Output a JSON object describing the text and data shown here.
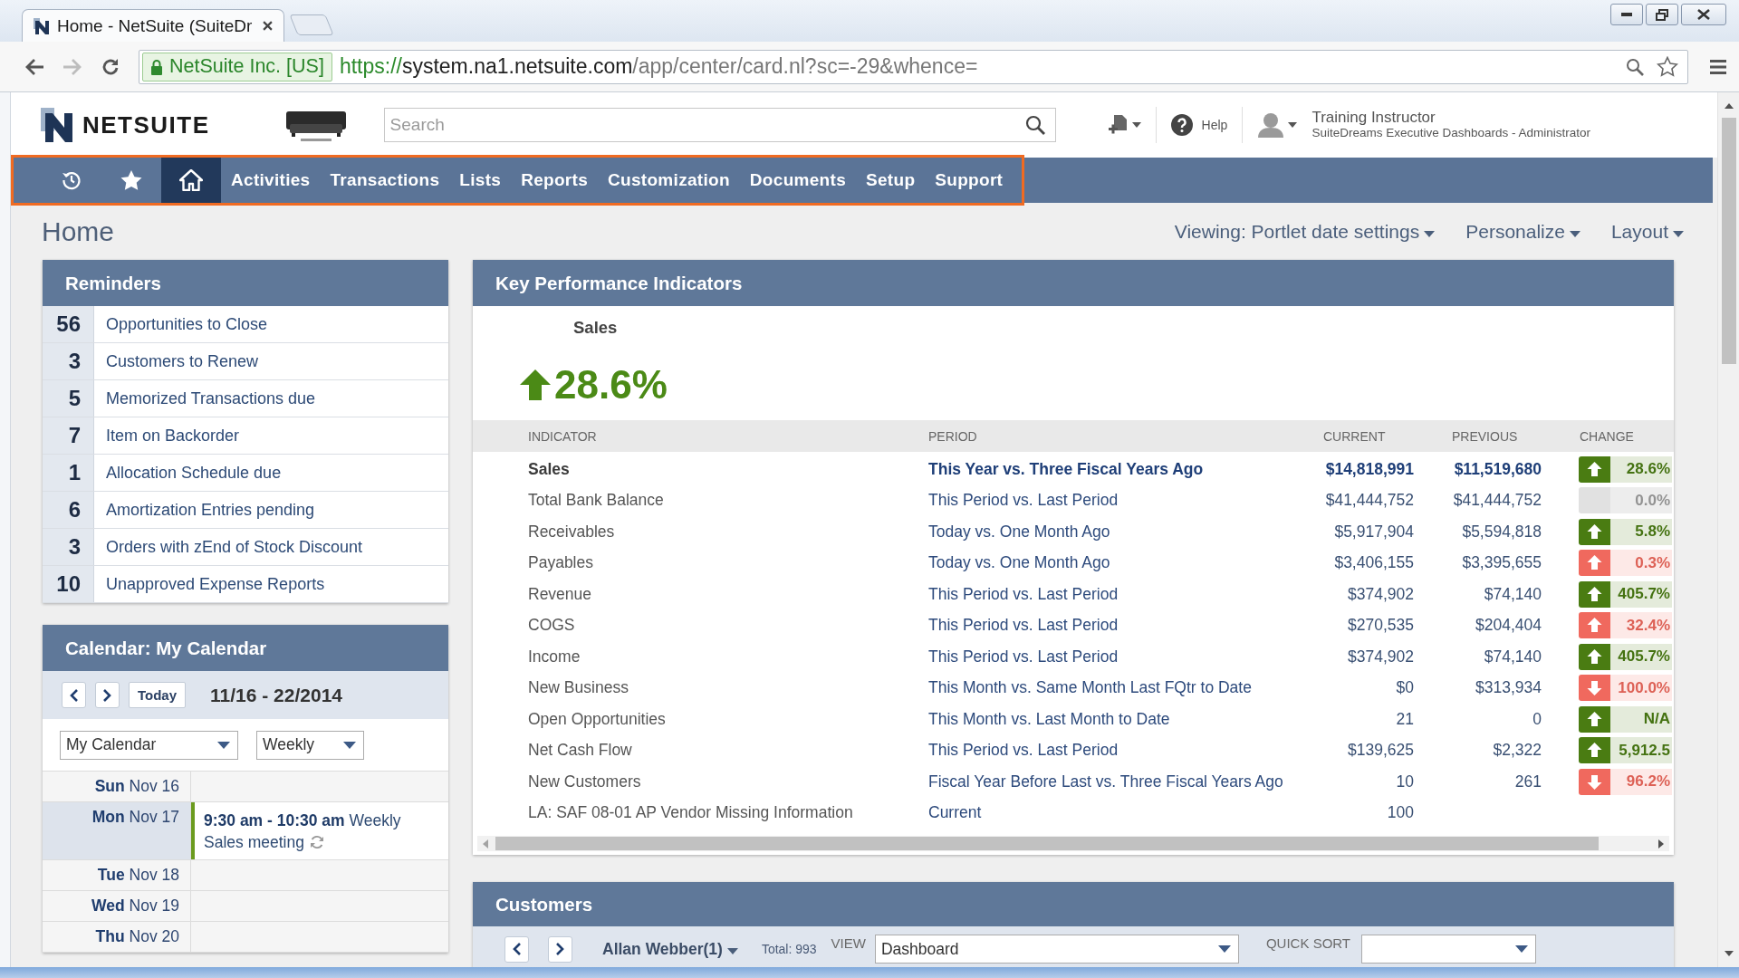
{
  "browser": {
    "tabs": [
      {
        "title": "Home - NetSuite (SuiteDr",
        "selected": true
      }
    ],
    "nav_buttons": [
      {
        "kind": "back",
        "disabled": false
      },
      {
        "kind": "forward",
        "disabled": true
      },
      {
        "kind": "reload",
        "disabled": false
      }
    ],
    "address": {
      "secure_label": "NetSuite Inc. [US]",
      "scheme": "https://",
      "host": "system.na1.netsuite.com",
      "path": "/app/center/card.nl?sc=-29&whence="
    }
  },
  "header": {
    "logo_text": "NETSUITE",
    "search": {
      "placeholder": "Search"
    },
    "help": "Help",
    "user": {
      "name": "Training Instructor",
      "role": "SuiteDreams Executive Dashboards - Administrator"
    }
  },
  "nav": {
    "highlighted": true,
    "items": [
      {
        "kind": "recent",
        "selected": false
      },
      {
        "kind": "favorites",
        "selected": false
      },
      {
        "kind": "home",
        "selected": true
      },
      {
        "kind": "menu",
        "label": "Activities",
        "selected": false
      },
      {
        "kind": "menu",
        "label": "Transactions",
        "selected": false
      },
      {
        "kind": "menu",
        "label": "Lists",
        "selected": false
      },
      {
        "kind": "menu",
        "label": "Reports",
        "selected": false
      },
      {
        "kind": "menu",
        "label": "Customization",
        "selected": false
      },
      {
        "kind": "menu",
        "label": "Documents",
        "selected": false
      },
      {
        "kind": "menu",
        "label": "Setup",
        "selected": false
      },
      {
        "kind": "menu",
        "label": "Support",
        "selected": false
      }
    ]
  },
  "page": {
    "title": "Home",
    "menus": [
      "Viewing: Portlet date settings",
      "Personalize",
      "Layout"
    ]
  },
  "reminders": {
    "title": "Reminders",
    "items": [
      {
        "count": "56",
        "label": "Opportunities to Close"
      },
      {
        "count": "3",
        "label": "Customers to Renew"
      },
      {
        "count": "5",
        "label": "Memorized Transactions due"
      },
      {
        "count": "7",
        "label": "Item on Backorder"
      },
      {
        "count": "1",
        "label": "Allocation Schedule due"
      },
      {
        "count": "6",
        "label": "Amortization Entries pending"
      },
      {
        "count": "3",
        "label": "Orders with zEnd of Stock Discount"
      },
      {
        "count": "10",
        "label": "Unapproved Expense Reports"
      }
    ]
  },
  "calendar": {
    "title": "Calendar: My Calendar",
    "today_button": "Today",
    "range": "11/16 - 22/2014",
    "calendar_select": "My Calendar",
    "view_select": "Weekly",
    "days": [
      {
        "weekday": "Sun",
        "date": "Nov 16",
        "today": false
      },
      {
        "weekday": "Mon",
        "date": "Nov 17",
        "today": true,
        "events": [
          {
            "text": "**9:30 am - 10:30 am** Weekly Sales meeting",
            "recurring": true
          }
        ]
      },
      {
        "weekday": "Tue",
        "date": "Nov 18",
        "today": false
      },
      {
        "weekday": "Wed",
        "date": "Nov 19",
        "today": false
      },
      {
        "weekday": "Thu",
        "date": "Nov 20",
        "today": false
      }
    ]
  },
  "kpi": {
    "title": "Key Performance Indicators",
    "headline": {
      "label": "Sales",
      "value": "28.6%",
      "kind": "increase",
      "color": "#4b8a16"
    },
    "columns": [
      "INDICATOR",
      "PERIOD",
      "CURRENT",
      "PREVIOUS",
      "CHANGE"
    ],
    "rows": [
      {
        "indicator": "Sales",
        "period": "This Year vs. Three Fiscal Years Ago",
        "current": "$14,818,991",
        "previous": "$11,519,680",
        "change": {
          "value": "28.6%",
          "kind": "increase",
          "color": "#4a7c12"
        },
        "selected": true
      },
      {
        "indicator": "Total Bank Balance",
        "period": "This Period vs. Last Period",
        "current": "$41,444,752",
        "previous": "$41,444,752",
        "change": {
          "value": "0.0%",
          "kind": "unchanged",
          "color": "#e1e1e1"
        },
        "selected": false
      },
      {
        "indicator": "Receivables",
        "period": "Today vs. One Month Ago",
        "current": "$5,917,904",
        "previous": "$5,594,818",
        "change": {
          "value": "5.8%",
          "kind": "increase",
          "color": "#4a7c12"
        },
        "selected": false
      },
      {
        "indicator": "Payables",
        "period": "Today vs. One Month Ago",
        "current": "$3,406,155",
        "previous": "$3,395,655",
        "change": {
          "value": "0.3%",
          "kind": "increase",
          "color": "#f0695e"
        },
        "selected": false
      },
      {
        "indicator": "Revenue",
        "period": "This Period vs. Last Period",
        "current": "$374,902",
        "previous": "$74,140",
        "change": {
          "value": "405.7%",
          "kind": "increase",
          "color": "#4a7c12"
        },
        "selected": false
      },
      {
        "indicator": "COGS",
        "period": "This Period vs. Last Period",
        "current": "$270,535",
        "previous": "$204,404",
        "change": {
          "value": "32.4%",
          "kind": "increase",
          "color": "#f0695e"
        },
        "selected": false
      },
      {
        "indicator": "Income",
        "period": "This Period vs. Last Period",
        "current": "$374,902",
        "previous": "$74,140",
        "change": {
          "value": "405.7%",
          "kind": "increase",
          "color": "#4a7c12"
        },
        "selected": false
      },
      {
        "indicator": "New Business",
        "period": "This Month vs. Same Month Last FQtr to Date",
        "current": "$0",
        "previous": "$313,934",
        "change": {
          "value": "100.0%",
          "kind": "decrease",
          "color": "#f0695e"
        },
        "selected": false
      },
      {
        "indicator": "Open Opportunities",
        "period": "This Month vs. Last Month to Date",
        "current": "21",
        "previous": "0",
        "change": {
          "value": "N/A",
          "kind": "increase",
          "color": "#4a7c12"
        },
        "selected": false
      },
      {
        "indicator": "Net Cash Flow",
        "period": "This Period vs. Last Period",
        "current": "$139,625",
        "previous": "$2,322",
        "change": {
          "value": "5,912.5",
          "kind": "increase",
          "color": "#4a7c12"
        },
        "selected": false
      },
      {
        "indicator": "New Customers",
        "period": "Fiscal Year Before Last vs. Three Fiscal Years Ago",
        "current": "10",
        "previous": "261",
        "change": {
          "value": "96.2%",
          "kind": "decrease",
          "color": "#f0695e"
        },
        "selected": false
      },
      {
        "indicator": "LA: SAF 08-01 AP Vendor Missing Information",
        "period": "Current",
        "current": "100",
        "selected": false
      }
    ]
  },
  "customers": {
    "title": "Customers",
    "owner": "Allan Webber(1)",
    "total": "Total: 993",
    "view_label": "VIEW",
    "view_select": "Dashboard",
    "quick_sort_label": "QUICK SORT"
  }
}
